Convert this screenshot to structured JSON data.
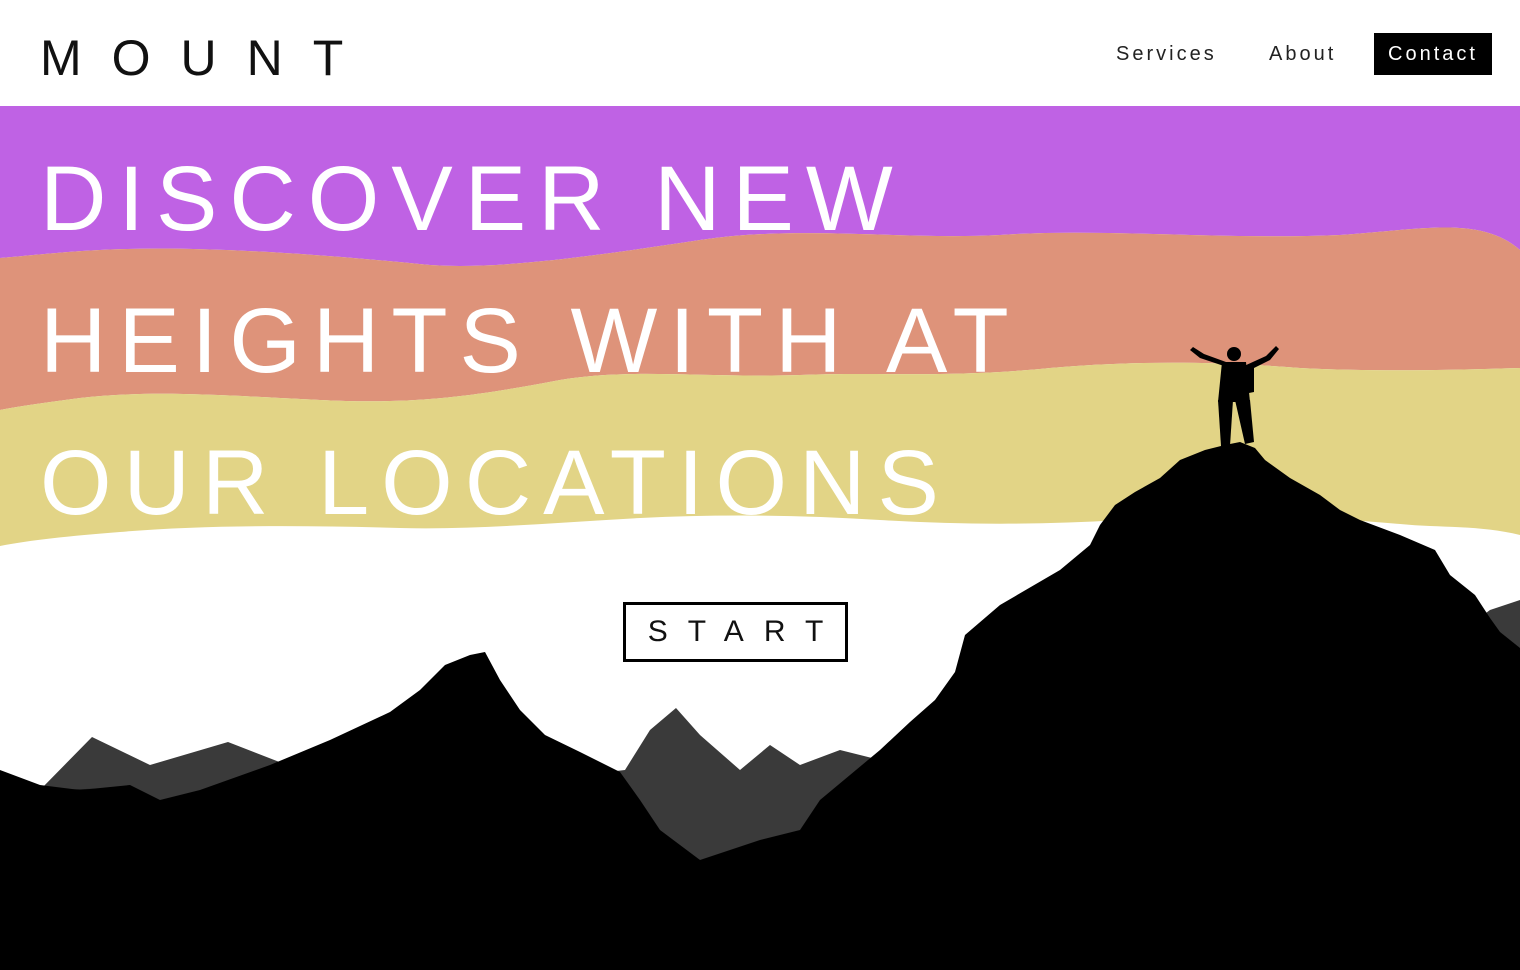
{
  "brand": {
    "logo_text": "MOUNT"
  },
  "nav": {
    "services": "Services",
    "about": "About",
    "contact": "Contact"
  },
  "hero": {
    "headline_lines": [
      "DISCOVER NEW",
      "HEIGHTS WITH AT",
      "OUR LOCATIONS"
    ],
    "cta_label": "START"
  },
  "colors": {
    "band_purple": "#bf62e4",
    "band_salmon": "#de937a",
    "band_yellow": "#e2d486",
    "mountain_black": "#000000",
    "mountain_dark_gray": "#2b2b2b",
    "mountain_mid_gray": "#404040"
  }
}
